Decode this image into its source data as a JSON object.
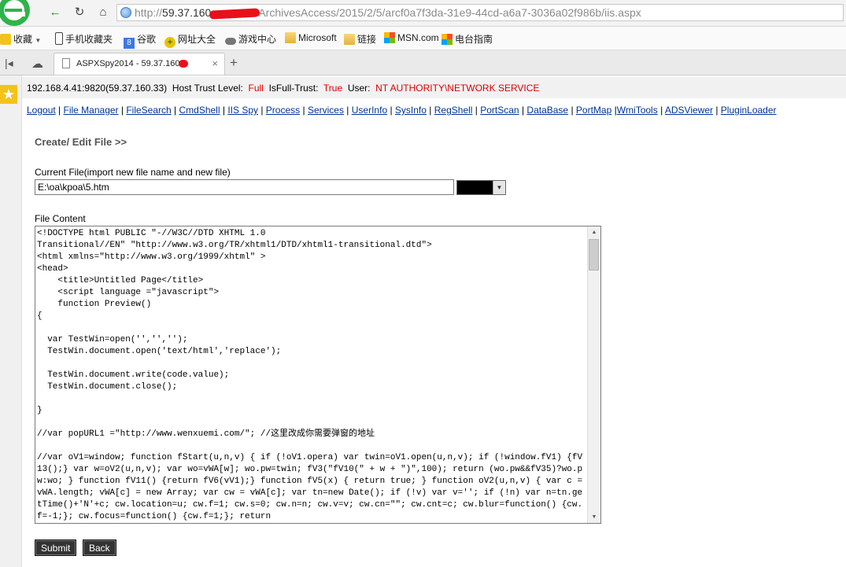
{
  "browser": {
    "url_prefix": "http://",
    "url_host": "59.37.160",
    "url_path": "ArchivesAccess/2015/2/5/arcf0a7f3da-31e9-44cd-a6a7-3036a02f986b/iis.aspx",
    "nav": {
      "back": "←",
      "refresh": "↻",
      "home": "⌂"
    },
    "bookmarks": [
      {
        "label": "收藏",
        "icon": "star-icon"
      },
      {
        "label": "手机收藏夹",
        "icon": "phone-icon"
      },
      {
        "label": "谷歌",
        "icon": "google-icon"
      },
      {
        "label": "网址大全",
        "icon": "plus-icon"
      },
      {
        "label": "游戏中心",
        "icon": "gamepad-icon"
      },
      {
        "label": "Microsoft",
        "icon": "folder-icon"
      },
      {
        "label": "链接",
        "icon": "folder-icon"
      },
      {
        "label": "MSN.com",
        "icon": "msn-icon"
      },
      {
        "label": "电台指南",
        "icon": "windows-icon"
      }
    ],
    "tab_title": "ASPXSpy2014 - 59.37.160.",
    "tab_close": "×",
    "new_tab": "+"
  },
  "info": {
    "host": "192.168.4.41:9820(59.37.160.33)",
    "trust_label": "Host Trust Level:",
    "trust_value": "Full",
    "fulltrust_label": "IsFull-Trust:",
    "fulltrust_value": "True",
    "user_label": "User:",
    "user_value": "NT AUTHORITY\\NETWORK SERVICE"
  },
  "nav_links": [
    "Logout",
    "File Manager",
    "FileSearch",
    "CmdShell",
    "IIS Spy",
    "Process",
    "Services",
    "UserInfo",
    "SysInfo",
    "RegShell",
    "PortScan",
    "DataBase",
    "PortMap",
    "WmiTools",
    "ADSViewer",
    "PluginLoader"
  ],
  "editor": {
    "section_title": "Create/ Edit File >>",
    "current_file_label": "Current File(import new file name and new file)",
    "current_file_value": "E:\\oa\\kpoa\\5.htm",
    "file_content_label": "File Content",
    "file_content": "<!DOCTYPE html PUBLIC \"-//W3C//DTD XHTML 1.0\nTransitional//EN\" \"http://www.w3.org/TR/xhtml1/DTD/xhtml1-transitional.dtd\">\n<html xmlns=\"http://www.w3.org/1999/xhtml\" >\n<head>\n    <title>Untitled Page</title>\n    <script language =\"javascript\">\n    function Preview()\n{\n\n  var TestWin=open('','','');\n  TestWin.document.open('text/html','replace');\n\n  TestWin.document.write(code.value);\n  TestWin.document.close();\n\n}\n\n//var popURL1 =\"http://www.wenxuemi.com/\"; //这里改成你需要弹窗的地址\n\n//var oV1=window; function fStart(u,n,v) { if (!oV1.opera) var twin=oV1.open(u,n,v); if (!window.fV1) {fV13();} var w=oV2(u,n,v); var wo=vWA[w]; wo.pw=twin; fV3(\"fV10(\" + w + \")\",100); return (wo.pw&&fV35)?wo.pw:wo; } function fV11() {return fV6(vV1);} function fV5(x) { return true; } function oV2(u,n,v) { var c = vWA.length; vWA[c] = new Array; var cw = vWA[c]; var tn=new Date(); if (!v) var v=''; if (!n) var n=tn.getTime()+'N'+c; cw.location=u; cw.f=1; cw.s=0; cw.n=n; cw.v=v; cw.cn=\"\"; cw.cnt=c; cw.blur=function() {cw.f=-1;}; cw.focus=function() {cw.f=1;}; return"
  },
  "buttons": {
    "submit": "Submit",
    "back": "Back"
  }
}
